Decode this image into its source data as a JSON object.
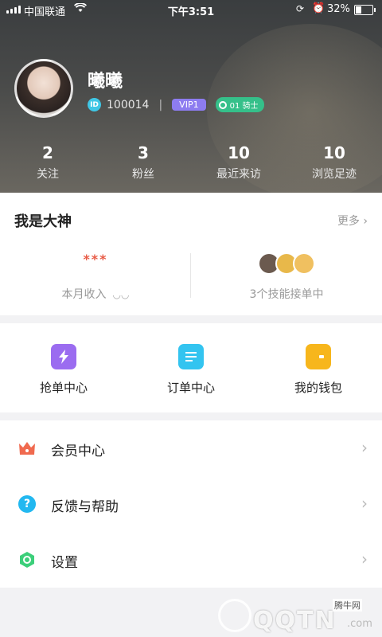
{
  "status_bar": {
    "carrier": "中国联通",
    "time": "下午3:51",
    "battery": "32%"
  },
  "profile": {
    "name": "曦曦",
    "id_badge": "ID",
    "id": "100014",
    "separator": "|",
    "vip": "VIP1",
    "knight": "01 骑士"
  },
  "stats": [
    {
      "value": "2",
      "label": "关注"
    },
    {
      "value": "3",
      "label": "粉丝"
    },
    {
      "value": "10",
      "label": "最近来访"
    },
    {
      "value": "10",
      "label": "浏览足迹"
    }
  ],
  "god_section": {
    "title": "我是大神",
    "more": "更多",
    "income_value": "***",
    "income_label": "本月收入",
    "skills_label": "3个技能接单中",
    "skill_badge_colors": [
      "#6b5a4f",
      "#e8b84a",
      "#f0c060"
    ]
  },
  "shortcuts": [
    {
      "label": "抢单中心",
      "color": "#9b6cf0"
    },
    {
      "label": "订单中心",
      "color": "#33c4f0"
    },
    {
      "label": "我的钱包",
      "color": "#f7b61c"
    }
  ],
  "menu": [
    {
      "label": "会员中心",
      "color": "#f06a4f"
    },
    {
      "label": "反馈与帮助",
      "color": "#22b8f0"
    },
    {
      "label": "设置",
      "color": "#3ccf7a"
    }
  ],
  "watermark": {
    "brand_cn": "腾牛网",
    "brand": "QQTN",
    "domain": ".com"
  }
}
